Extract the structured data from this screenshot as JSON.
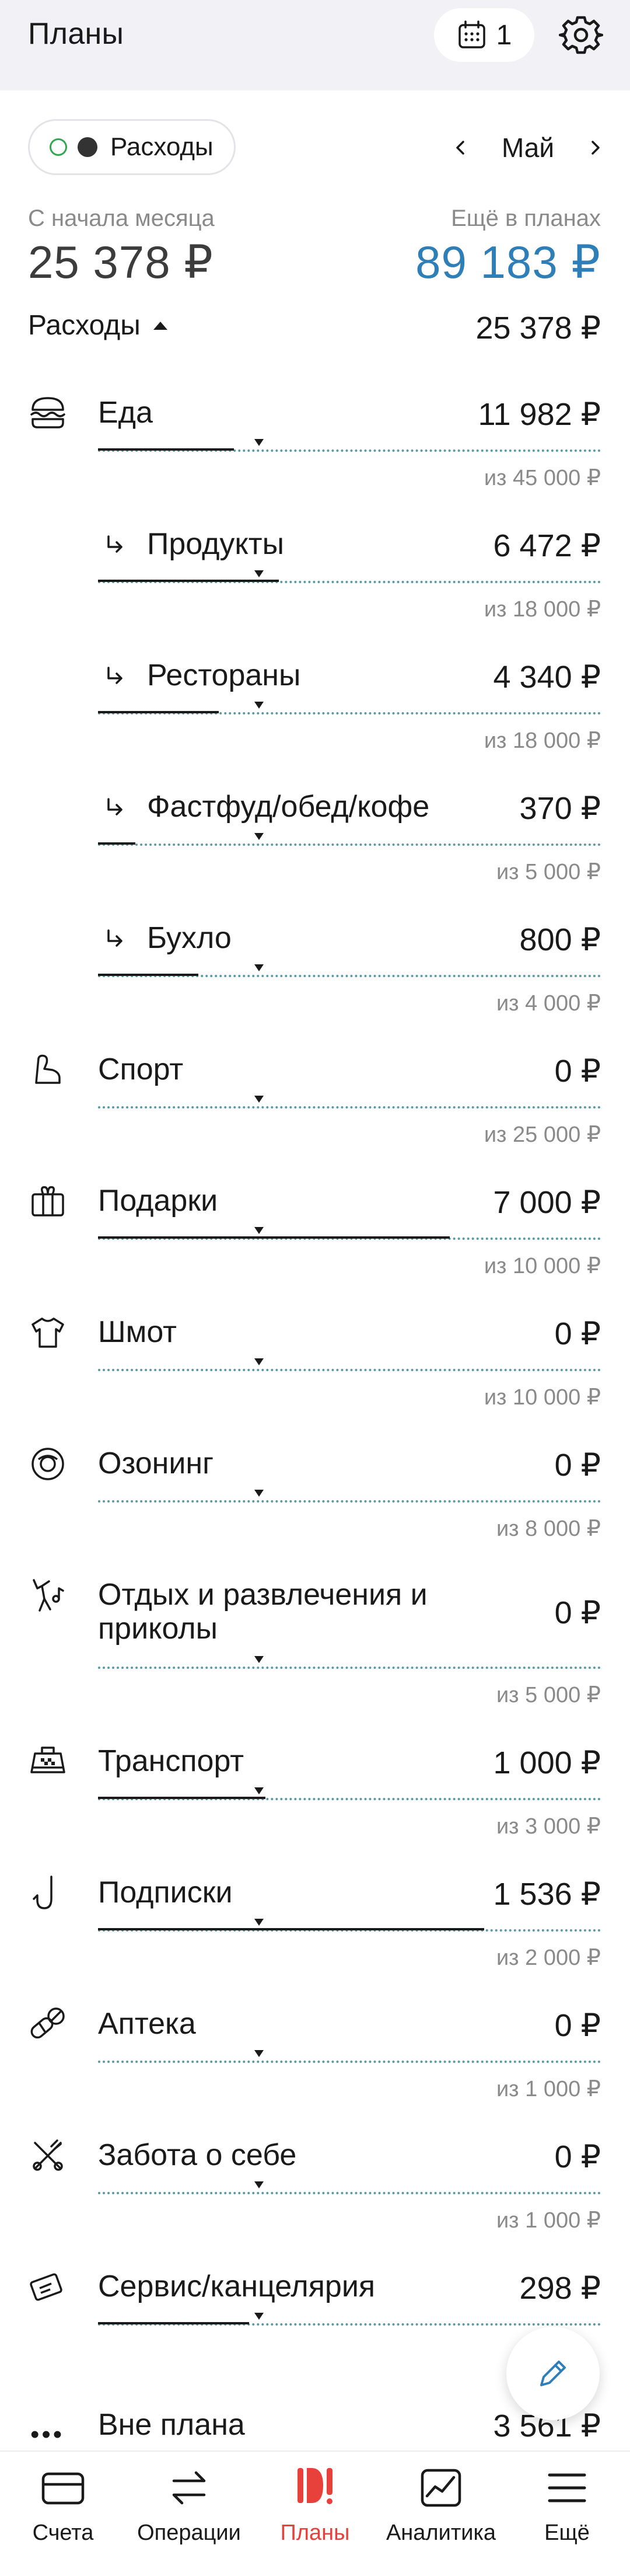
{
  "header": {
    "title": "Планы",
    "calendar_count": "1"
  },
  "filter": {
    "label": "Расходы"
  },
  "month": {
    "label": "Май"
  },
  "summary": {
    "spent_label": "С начала месяца",
    "spent_value": "25 378 ₽",
    "planned_label": "Ещё в планах",
    "planned_value": "89 183 ₽",
    "accent_color": "#2e7eb8"
  },
  "section": {
    "title": "Расходы",
    "total": "25 378 ₽"
  },
  "categories": [
    {
      "name": "Еда",
      "amount": "11 982 ₽",
      "plan": "из 45 000 ₽",
      "progress": 0.27,
      "icon": "burger-icon"
    },
    {
      "name": "Продукты",
      "amount": "6 472 ₽",
      "plan": "из 18 000 ₽",
      "progress": 0.36,
      "icon": "subcategory-arrow-icon"
    },
    {
      "name": "Рестораны",
      "amount": "4 340 ₽",
      "plan": "из 18 000 ₽",
      "progress": 0.24,
      "icon": "subcategory-arrow-icon"
    },
    {
      "name": "Фастфуд/обед/кофе",
      "amount": "370 ₽",
      "plan": "из 5 000 ₽",
      "progress": 0.074,
      "icon": "subcategory-arrow-icon"
    },
    {
      "name": "Бухло",
      "amount": "800 ₽",
      "plan": "из 4 000 ₽",
      "progress": 0.2,
      "icon": "subcategory-arrow-icon"
    },
    {
      "name": "Спорт",
      "amount": "0 ₽",
      "plan": "из 25 000 ₽",
      "progress": 0,
      "icon": "sport-icon"
    },
    {
      "name": "Подарки",
      "amount": "7 000 ₽",
      "plan": "из 10 000 ₽",
      "progress": 0.7,
      "icon": "gift-icon"
    },
    {
      "name": "Шмот",
      "amount": "0 ₽",
      "plan": "из 10 000 ₽",
      "progress": 0,
      "icon": "clothes-icon"
    },
    {
      "name": "Озонинг",
      "amount": "0 ₽",
      "plan": "из 8 000 ₽",
      "progress": 0,
      "icon": "ozon-icon"
    },
    {
      "name_line1": "Отдых и развлечения и",
      "name_line2": "приколы",
      "amount": "0 ₽",
      "plan": "из 5 000 ₽",
      "progress": 0,
      "icon": "entertainment-icon"
    },
    {
      "name": "Транспорт",
      "amount": "1 000 ₽",
      "plan": "из 3 000 ₽",
      "progress": 0.333,
      "icon": "taxi-icon"
    },
    {
      "name": "Подписки",
      "amount": "1 536 ₽",
      "plan": "из 2 000 ₽",
      "progress": 0.768,
      "icon": "hook-icon"
    },
    {
      "name": "Аптека",
      "amount": "0 ₽",
      "plan": "из 1 000 ₽",
      "progress": 0,
      "icon": "pill-icon"
    },
    {
      "name": "Забота о себе",
      "amount": "0 ₽",
      "plan": "из 1 000 ₽",
      "progress": 0,
      "icon": "self-care-icon"
    },
    {
      "name": "Сервис/канцелярия",
      "amount": "298 ₽",
      "plan": "",
      "progress": 0.3,
      "icon": "service-icon"
    }
  ],
  "extra": {
    "name": "Вне плана",
    "amount": "3 561 ₽"
  },
  "nav": [
    {
      "label": "Счета",
      "icon": "card-icon"
    },
    {
      "label": "Операции",
      "icon": "transfer-icon"
    },
    {
      "label": "Планы",
      "icon": "plans-icon",
      "active": true,
      "color": "#e8413b"
    },
    {
      "label": "Аналитика",
      "icon": "chart-icon"
    },
    {
      "label": "Ещё",
      "icon": "menu-icon"
    }
  ]
}
